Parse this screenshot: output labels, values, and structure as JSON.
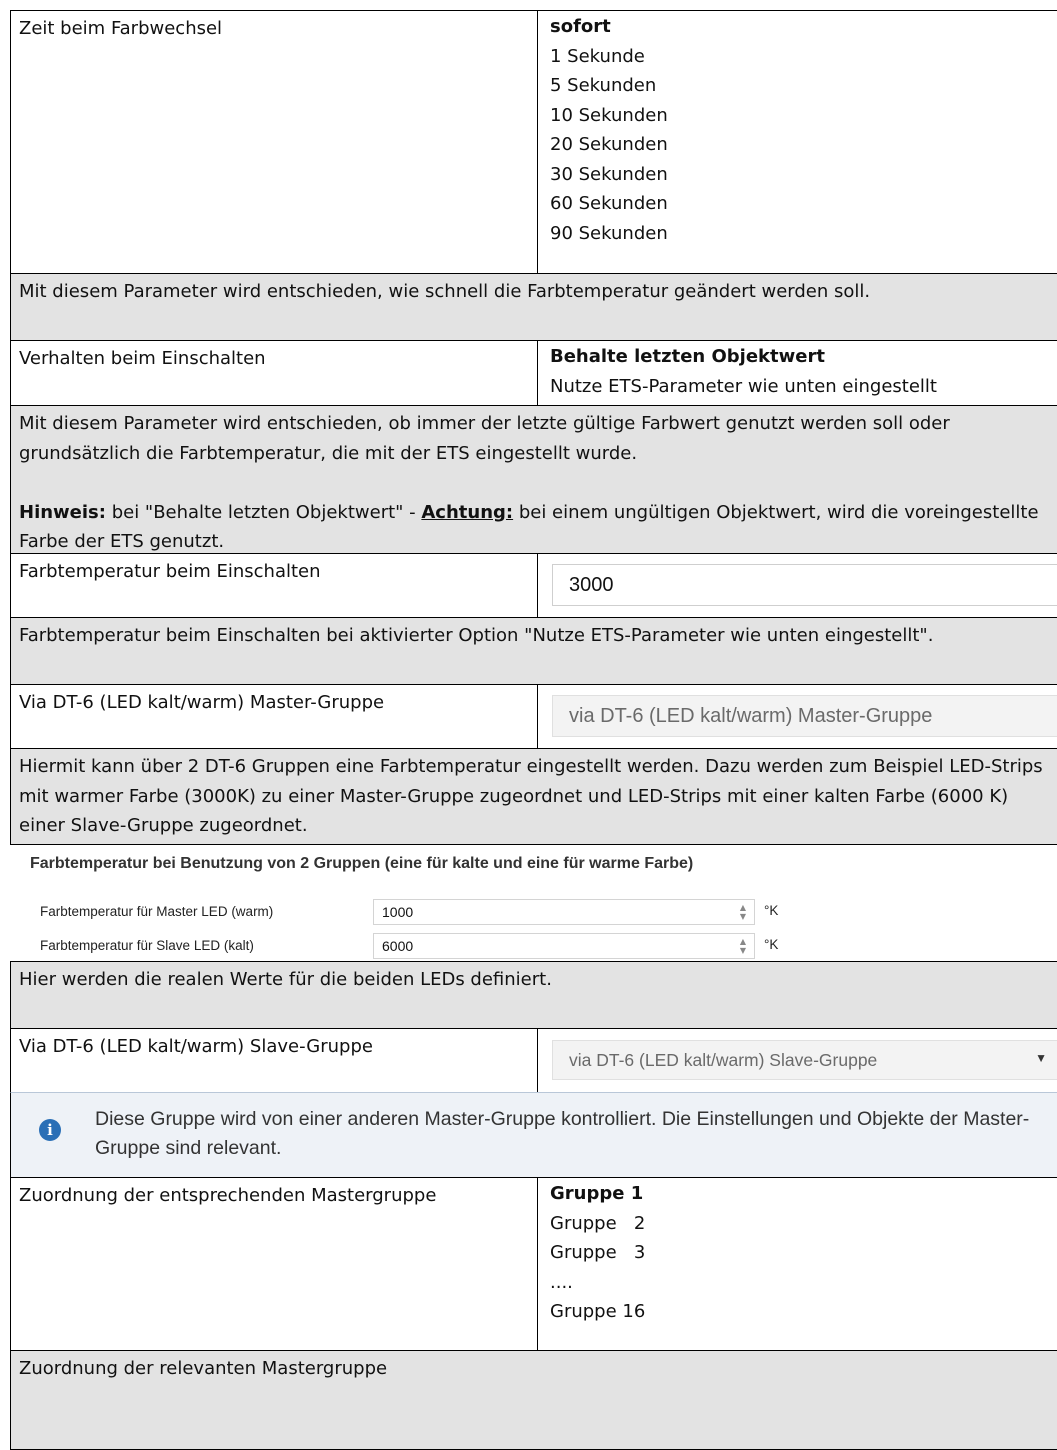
{
  "rows": {
    "farbwechsel": {
      "label": "Zeit beim Farbwechsel",
      "options": [
        "sofort",
        "1 Sekunde",
        "5 Sekunden",
        "10 Sekunden",
        "20 Sekunden",
        "30 Sekunden",
        "60 Sekunden",
        "90 Sekunden"
      ],
      "description": "Mit diesem Parameter wird entschieden, wie schnell die Farbtemperatur geändert werden soll."
    },
    "einschalten": {
      "label": "Verhalten beim Einschalten",
      "options": [
        "Behalte letzten Objektwert",
        "Nutze ETS-Parameter wie unten eingestellt"
      ],
      "description_1": "Mit diesem Parameter wird entschieden, ob immer der letzte gültige Farbwert genutzt werden soll oder grundsätzlich die Farbtemperatur, die mit der ETS eingestellt wurde.",
      "hint_label": "Hinweis:",
      "hint_text_1": " bei \"Behalte letzten Objektwert\" - ",
      "attention_label": "Achtung:",
      "hint_text_2": " bei einem ungültigen Objektwert, wird die voreingestellte Farbe der ETS genutzt."
    },
    "farbtemp_einschalten": {
      "label": "Farbtemperatur beim Einschalten",
      "value": "3000",
      "description": "Farbtemperatur beim Einschalten bei aktivierter Option \"Nutze ETS-Parameter wie unten eingestellt\"."
    },
    "master": {
      "label": "Via DT-6 (LED kalt/warm) Master-Gruppe",
      "value": "via DT-6 (LED kalt/warm) Master-Gruppe",
      "description": "Hiermit kann über 2 DT-6 Gruppen eine Farbtemperatur eingestellt werden. Dazu werden zum Beispiel LED-Strips mit warmer Farbe (3000K) zu einer Master-Gruppe zugeordnet und LED-Strips mit einer kalten Farbe (6000 K) einer Slave-Gruppe zugeordnet."
    },
    "two_groups": {
      "title": "Farbtemperatur bei Benutzung von 2 Gruppen (eine für kalte und eine für warme Farbe)",
      "master_label": "Farbtemperatur für Master LED (warm)",
      "master_value": "1000",
      "slave_label": "Farbtemperatur für Slave LED (kalt)",
      "slave_value": "6000",
      "unit": "°K",
      "description": "Hier werden die realen Werte für die beiden LEDs definiert."
    },
    "slave": {
      "label": "Via DT-6 (LED kalt/warm) Slave-Gruppe",
      "value": "via DT-6 (LED kalt/warm) Slave-Gruppe",
      "info": "Diese Gruppe wird von einer anderen Master-Gruppe kontrolliert. Die Einstellungen und Objekte der Master-Gruppe sind relevant."
    },
    "zuordnung": {
      "label": "Zuordnung der entsprechenden Mastergruppe",
      "options": [
        "Gruppe 1",
        "Gruppe   2",
        "Gruppe   3",
        "....",
        "Gruppe 16"
      ],
      "description": "Zuordnung der relevanten Mastergruppe"
    }
  }
}
